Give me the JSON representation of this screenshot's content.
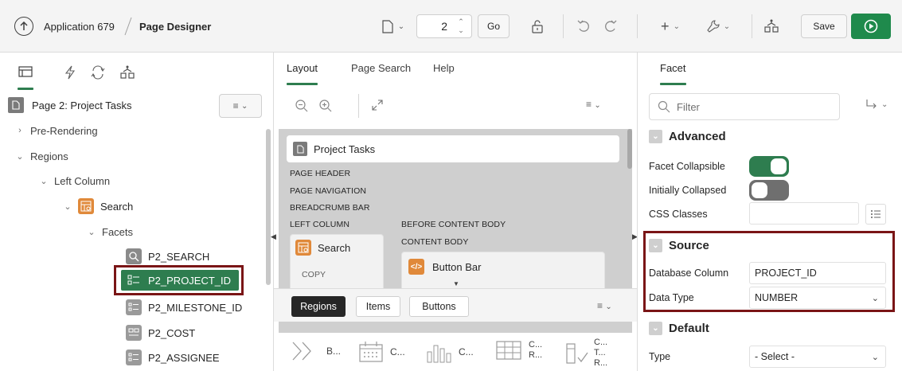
{
  "toolbar": {
    "app_title": "Application 679",
    "page_designer": "Page Designer",
    "page_number": "2",
    "go_label": "Go",
    "save_label": "Save"
  },
  "left_panel": {
    "page_title": "Page 2: Project Tasks",
    "tree": {
      "pre_rendering": "Pre-Rendering",
      "regions": "Regions",
      "left_column": "Left Column",
      "search": "Search",
      "facets": "Facets",
      "items": [
        "P2_SEARCH",
        "P2_PROJECT_ID",
        "P2_MILESTONE_ID",
        "P2_COST",
        "P2_ASSIGNEE"
      ]
    }
  },
  "middle_panel": {
    "tabs": [
      "Layout",
      "Page Search",
      "Help"
    ],
    "region_title": "Project Tasks",
    "positions": {
      "page_header": "PAGE HEADER",
      "page_navigation": "PAGE NAVIGATION",
      "breadcrumb_bar": "BREADCRUMB BAR",
      "left_column": "LEFT COLUMN",
      "before_content_body": "BEFORE CONTENT BODY",
      "content_body": "CONTENT BODY",
      "copy": "COPY"
    },
    "search_card": "Search",
    "button_bar": "Button Bar",
    "gallery_tabs": [
      "Regions",
      "Items",
      "Buttons"
    ],
    "gallery_items": [
      "B...",
      "C...",
      "C...",
      "C...",
      "R...",
      "C...",
      "T...",
      "R..."
    ]
  },
  "right_panel": {
    "tab": "Facet",
    "filter_placeholder": "Filter",
    "advanced": {
      "title": "Advanced",
      "facet_collapsible": "Facet Collapsible",
      "initially_collapsed": "Initially Collapsed",
      "css_classes": "CSS Classes"
    },
    "source": {
      "title": "Source",
      "database_column_label": "Database Column",
      "database_column_value": "PROJECT_ID",
      "data_type_label": "Data Type",
      "data_type_value": "NUMBER"
    },
    "default": {
      "title": "Default",
      "type_label": "Type",
      "type_value": "- Select -"
    }
  },
  "colors": {
    "accent_green": "#2e7d4f",
    "run_green": "#1f8a4c",
    "highlight": "#7a1516",
    "item_icon_orange": "#e0893a"
  }
}
